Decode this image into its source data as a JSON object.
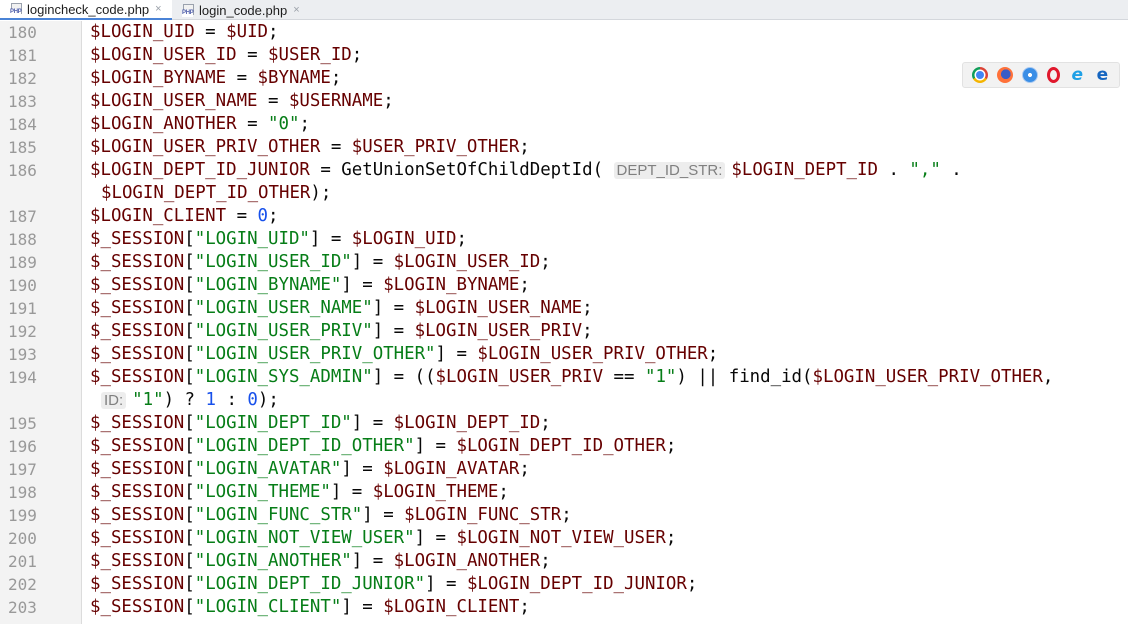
{
  "tabs": [
    {
      "label": "logincheck_code.php",
      "icon": "php-file-icon",
      "active": true
    },
    {
      "label": "login_code.php",
      "icon": "php-file-icon",
      "active": false
    }
  ],
  "tab_icon_label": "PHP",
  "tab_close_glyph": "×",
  "browser_icons": [
    "chrome-icon",
    "firefox-icon",
    "safari-icon",
    "opera-icon",
    "internet-explorer-icon",
    "edge-icon"
  ],
  "browser_glyphs": {
    "ie": "e",
    "edge": "e"
  },
  "lines": [
    {
      "num": "180",
      "tokens": [
        {
          "t": "$LOGIN_UID",
          "c": "v"
        },
        {
          "t": " = ",
          "c": "f"
        },
        {
          "t": "$UID",
          "c": "v"
        },
        {
          "t": ";",
          "c": "f"
        }
      ]
    },
    {
      "num": "181",
      "tokens": [
        {
          "t": "$LOGIN_USER_ID",
          "c": "v"
        },
        {
          "t": " = ",
          "c": "f"
        },
        {
          "t": "$USER_ID",
          "c": "v"
        },
        {
          "t": ";",
          "c": "f"
        }
      ]
    },
    {
      "num": "182",
      "tokens": [
        {
          "t": "$LOGIN_BYNAME",
          "c": "v"
        },
        {
          "t": " = ",
          "c": "f"
        },
        {
          "t": "$BYNAME",
          "c": "v"
        },
        {
          "t": ";",
          "c": "f"
        }
      ]
    },
    {
      "num": "183",
      "tokens": [
        {
          "t": "$LOGIN_USER_NAME",
          "c": "v"
        },
        {
          "t": " = ",
          "c": "f"
        },
        {
          "t": "$USERNAME",
          "c": "v"
        },
        {
          "t": ";",
          "c": "f"
        }
      ]
    },
    {
      "num": "184",
      "tokens": [
        {
          "t": "$LOGIN_ANOTHER",
          "c": "v"
        },
        {
          "t": " = ",
          "c": "f"
        },
        {
          "t": "\"0\"",
          "c": "s"
        },
        {
          "t": ";",
          "c": "f"
        }
      ]
    },
    {
      "num": "185",
      "tokens": [
        {
          "t": "$LOGIN_USER_PRIV_OTHER",
          "c": "v"
        },
        {
          "t": " = ",
          "c": "f"
        },
        {
          "t": "$USER_PRIV_OTHER",
          "c": "v"
        },
        {
          "t": ";",
          "c": "f"
        }
      ]
    },
    {
      "num": "186",
      "tokens": [
        {
          "t": "$LOGIN_DEPT_ID_JUNIOR",
          "c": "v"
        },
        {
          "t": " = GetUnionSetOfChildDeptId( ",
          "c": "f"
        },
        {
          "t": "DEPT_ID_STR:",
          "c": "hint"
        },
        {
          "t": "$LOGIN_DEPT_ID",
          "c": "v"
        },
        {
          "t": " . ",
          "c": "f"
        },
        {
          "t": "\",\"",
          "c": "s"
        },
        {
          "t": " .",
          "c": "f"
        }
      ]
    },
    {
      "num": "",
      "cont": true,
      "tokens": [
        {
          "t": "$LOGIN_DEPT_ID_OTHER",
          "c": "v"
        },
        {
          "t": ");",
          "c": "f"
        }
      ]
    },
    {
      "num": "187",
      "tokens": [
        {
          "t": "$LOGIN_CLIENT",
          "c": "v"
        },
        {
          "t": " = ",
          "c": "f"
        },
        {
          "t": "0",
          "c": "n"
        },
        {
          "t": ";",
          "c": "f"
        }
      ]
    },
    {
      "num": "188",
      "tokens": [
        {
          "t": "$_SESSION",
          "c": "v"
        },
        {
          "t": "[",
          "c": "f"
        },
        {
          "t": "\"LOGIN_UID\"",
          "c": "s"
        },
        {
          "t": "] = ",
          "c": "f"
        },
        {
          "t": "$LOGIN_UID",
          "c": "v"
        },
        {
          "t": ";",
          "c": "f"
        }
      ]
    },
    {
      "num": "189",
      "tokens": [
        {
          "t": "$_SESSION",
          "c": "v"
        },
        {
          "t": "[",
          "c": "f"
        },
        {
          "t": "\"LOGIN_USER_ID\"",
          "c": "s"
        },
        {
          "t": "] = ",
          "c": "f"
        },
        {
          "t": "$LOGIN_USER_ID",
          "c": "v"
        },
        {
          "t": ";",
          "c": "f"
        }
      ]
    },
    {
      "num": "190",
      "tokens": [
        {
          "t": "$_SESSION",
          "c": "v"
        },
        {
          "t": "[",
          "c": "f"
        },
        {
          "t": "\"LOGIN_BYNAME\"",
          "c": "s"
        },
        {
          "t": "] = ",
          "c": "f"
        },
        {
          "t": "$LOGIN_BYNAME",
          "c": "v"
        },
        {
          "t": ";",
          "c": "f"
        }
      ]
    },
    {
      "num": "191",
      "tokens": [
        {
          "t": "$_SESSION",
          "c": "v"
        },
        {
          "t": "[",
          "c": "f"
        },
        {
          "t": "\"LOGIN_USER_NAME\"",
          "c": "s"
        },
        {
          "t": "] = ",
          "c": "f"
        },
        {
          "t": "$LOGIN_USER_NAME",
          "c": "v"
        },
        {
          "t": ";",
          "c": "f"
        }
      ]
    },
    {
      "num": "192",
      "tokens": [
        {
          "t": "$_SESSION",
          "c": "v"
        },
        {
          "t": "[",
          "c": "f"
        },
        {
          "t": "\"LOGIN_USER_PRIV\"",
          "c": "s"
        },
        {
          "t": "] = ",
          "c": "f"
        },
        {
          "t": "$LOGIN_USER_PRIV",
          "c": "v"
        },
        {
          "t": ";",
          "c": "f"
        }
      ]
    },
    {
      "num": "193",
      "tokens": [
        {
          "t": "$_SESSION",
          "c": "v"
        },
        {
          "t": "[",
          "c": "f"
        },
        {
          "t": "\"LOGIN_USER_PRIV_OTHER\"",
          "c": "s"
        },
        {
          "t": "] = ",
          "c": "f"
        },
        {
          "t": "$LOGIN_USER_PRIV_OTHER",
          "c": "v"
        },
        {
          "t": ";",
          "c": "f"
        }
      ]
    },
    {
      "num": "194",
      "tokens": [
        {
          "t": "$_SESSION",
          "c": "v"
        },
        {
          "t": "[",
          "c": "f"
        },
        {
          "t": "\"LOGIN_SYS_ADMIN\"",
          "c": "s"
        },
        {
          "t": "] = ((",
          "c": "f"
        },
        {
          "t": "$LOGIN_USER_PRIV",
          "c": "v"
        },
        {
          "t": " == ",
          "c": "f"
        },
        {
          "t": "\"1\"",
          "c": "s"
        },
        {
          "t": ") || find_id(",
          "c": "f"
        },
        {
          "t": "$LOGIN_USER_PRIV_OTHER",
          "c": "v"
        },
        {
          "t": ",",
          "c": "f"
        }
      ]
    },
    {
      "num": "",
      "cont": true,
      "tokens": [
        {
          "t": "ID:",
          "c": "hint"
        },
        {
          "t": "\"1\"",
          "c": "s"
        },
        {
          "t": ") ? ",
          "c": "f"
        },
        {
          "t": "1",
          "c": "n"
        },
        {
          "t": " : ",
          "c": "f"
        },
        {
          "t": "0",
          "c": "n"
        },
        {
          "t": ");",
          "c": "f"
        }
      ]
    },
    {
      "num": "195",
      "tokens": [
        {
          "t": "$_SESSION",
          "c": "v"
        },
        {
          "t": "[",
          "c": "f"
        },
        {
          "t": "\"LOGIN_DEPT_ID\"",
          "c": "s"
        },
        {
          "t": "] = ",
          "c": "f"
        },
        {
          "t": "$LOGIN_DEPT_ID",
          "c": "v"
        },
        {
          "t": ";",
          "c": "f"
        }
      ]
    },
    {
      "num": "196",
      "tokens": [
        {
          "t": "$_SESSION",
          "c": "v"
        },
        {
          "t": "[",
          "c": "f"
        },
        {
          "t": "\"LOGIN_DEPT_ID_OTHER\"",
          "c": "s"
        },
        {
          "t": "] = ",
          "c": "f"
        },
        {
          "t": "$LOGIN_DEPT_ID_OTHER",
          "c": "v"
        },
        {
          "t": ";",
          "c": "f"
        }
      ]
    },
    {
      "num": "197",
      "tokens": [
        {
          "t": "$_SESSION",
          "c": "v"
        },
        {
          "t": "[",
          "c": "f"
        },
        {
          "t": "\"LOGIN_AVATAR\"",
          "c": "s"
        },
        {
          "t": "] = ",
          "c": "f"
        },
        {
          "t": "$LOGIN_AVATAR",
          "c": "v"
        },
        {
          "t": ";",
          "c": "f"
        }
      ]
    },
    {
      "num": "198",
      "tokens": [
        {
          "t": "$_SESSION",
          "c": "v"
        },
        {
          "t": "[",
          "c": "f"
        },
        {
          "t": "\"LOGIN_THEME\"",
          "c": "s"
        },
        {
          "t": "] = ",
          "c": "f"
        },
        {
          "t": "$LOGIN_THEME",
          "c": "v"
        },
        {
          "t": ";",
          "c": "f"
        }
      ]
    },
    {
      "num": "199",
      "tokens": [
        {
          "t": "$_SESSION",
          "c": "v"
        },
        {
          "t": "[",
          "c": "f"
        },
        {
          "t": "\"LOGIN_FUNC_STR\"",
          "c": "s"
        },
        {
          "t": "] = ",
          "c": "f"
        },
        {
          "t": "$LOGIN_FUNC_STR",
          "c": "v"
        },
        {
          "t": ";",
          "c": "f"
        }
      ]
    },
    {
      "num": "200",
      "tokens": [
        {
          "t": "$_SESSION",
          "c": "v"
        },
        {
          "t": "[",
          "c": "f"
        },
        {
          "t": "\"LOGIN_NOT_VIEW_USER\"",
          "c": "s"
        },
        {
          "t": "] = ",
          "c": "f"
        },
        {
          "t": "$LOGIN_NOT_VIEW_USER",
          "c": "v"
        },
        {
          "t": ";",
          "c": "f"
        }
      ]
    },
    {
      "num": "201",
      "tokens": [
        {
          "t": "$_SESSION",
          "c": "v"
        },
        {
          "t": "[",
          "c": "f"
        },
        {
          "t": "\"LOGIN_ANOTHER\"",
          "c": "s"
        },
        {
          "t": "] = ",
          "c": "f"
        },
        {
          "t": "$LOGIN_ANOTHER",
          "c": "v"
        },
        {
          "t": ";",
          "c": "f"
        }
      ]
    },
    {
      "num": "202",
      "tokens": [
        {
          "t": "$_SESSION",
          "c": "v"
        },
        {
          "t": "[",
          "c": "f"
        },
        {
          "t": "\"LOGIN_DEPT_ID_JUNIOR\"",
          "c": "s"
        },
        {
          "t": "] = ",
          "c": "f"
        },
        {
          "t": "$LOGIN_DEPT_ID_JUNIOR",
          "c": "v"
        },
        {
          "t": ";",
          "c": "f"
        }
      ]
    },
    {
      "num": "203",
      "tokens": [
        {
          "t": "$_SESSION",
          "c": "v"
        },
        {
          "t": "[",
          "c": "f"
        },
        {
          "t": "\"LOGIN_CLIENT\"",
          "c": "s"
        },
        {
          "t": "] = ",
          "c": "f"
        },
        {
          "t": "$LOGIN_CLIENT",
          "c": "v"
        },
        {
          "t": ";",
          "c": "f"
        }
      ]
    }
  ]
}
